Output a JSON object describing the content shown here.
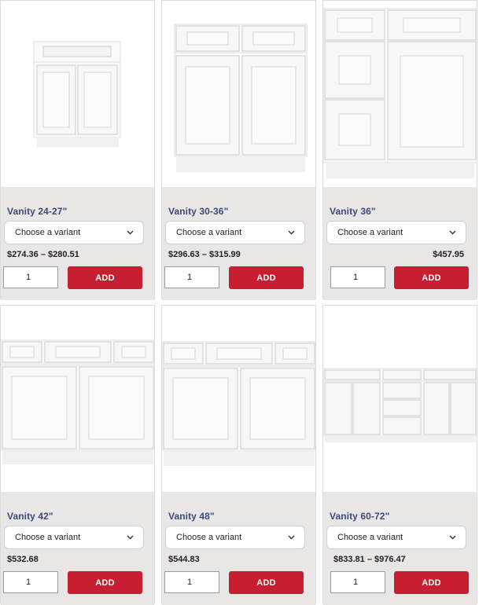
{
  "products": [
    {
      "title": "Vanity 24-27\"",
      "variant_placeholder": "Choose a variant",
      "price": "$274.36 – $280.51",
      "qty": "1",
      "add_label": "ADD",
      "image_icon": "vanity-cabinet-two-door"
    },
    {
      "title": "Vanity 30-36\"",
      "variant_placeholder": "Choose a variant",
      "price": "$296.63 – $315.99",
      "qty": "1",
      "add_label": "ADD",
      "image_icon": "vanity-cabinet-two-door-two-drawer"
    },
    {
      "title": "Vanity 36\"",
      "variant_placeholder": "Choose a variant",
      "price": "$457.95",
      "qty": "1",
      "add_label": "ADD",
      "image_icon": "vanity-cabinet-drawer-stack"
    },
    {
      "title": "Vanity 42\"",
      "variant_placeholder": "Choose a variant",
      "price": "$532.68",
      "qty": "1",
      "add_label": "ADD",
      "image_icon": "vanity-cabinet-three-drawer"
    },
    {
      "title": "Vanity 48\"",
      "variant_placeholder": "Choose a variant",
      "price": "$544.83",
      "qty": "1",
      "add_label": "ADD",
      "image_icon": "vanity-cabinet-three-drawer"
    },
    {
      "title": "Vanity 60-72\"",
      "variant_placeholder": "Choose a variant",
      "price": "$833.81 – $976.47",
      "qty": "1",
      "add_label": "ADD",
      "image_icon": "vanity-cabinet-double-sink"
    }
  ],
  "colors": {
    "accent": "#c71f31",
    "title": "#3a4a7a",
    "panel": "#e9e6e6"
  }
}
